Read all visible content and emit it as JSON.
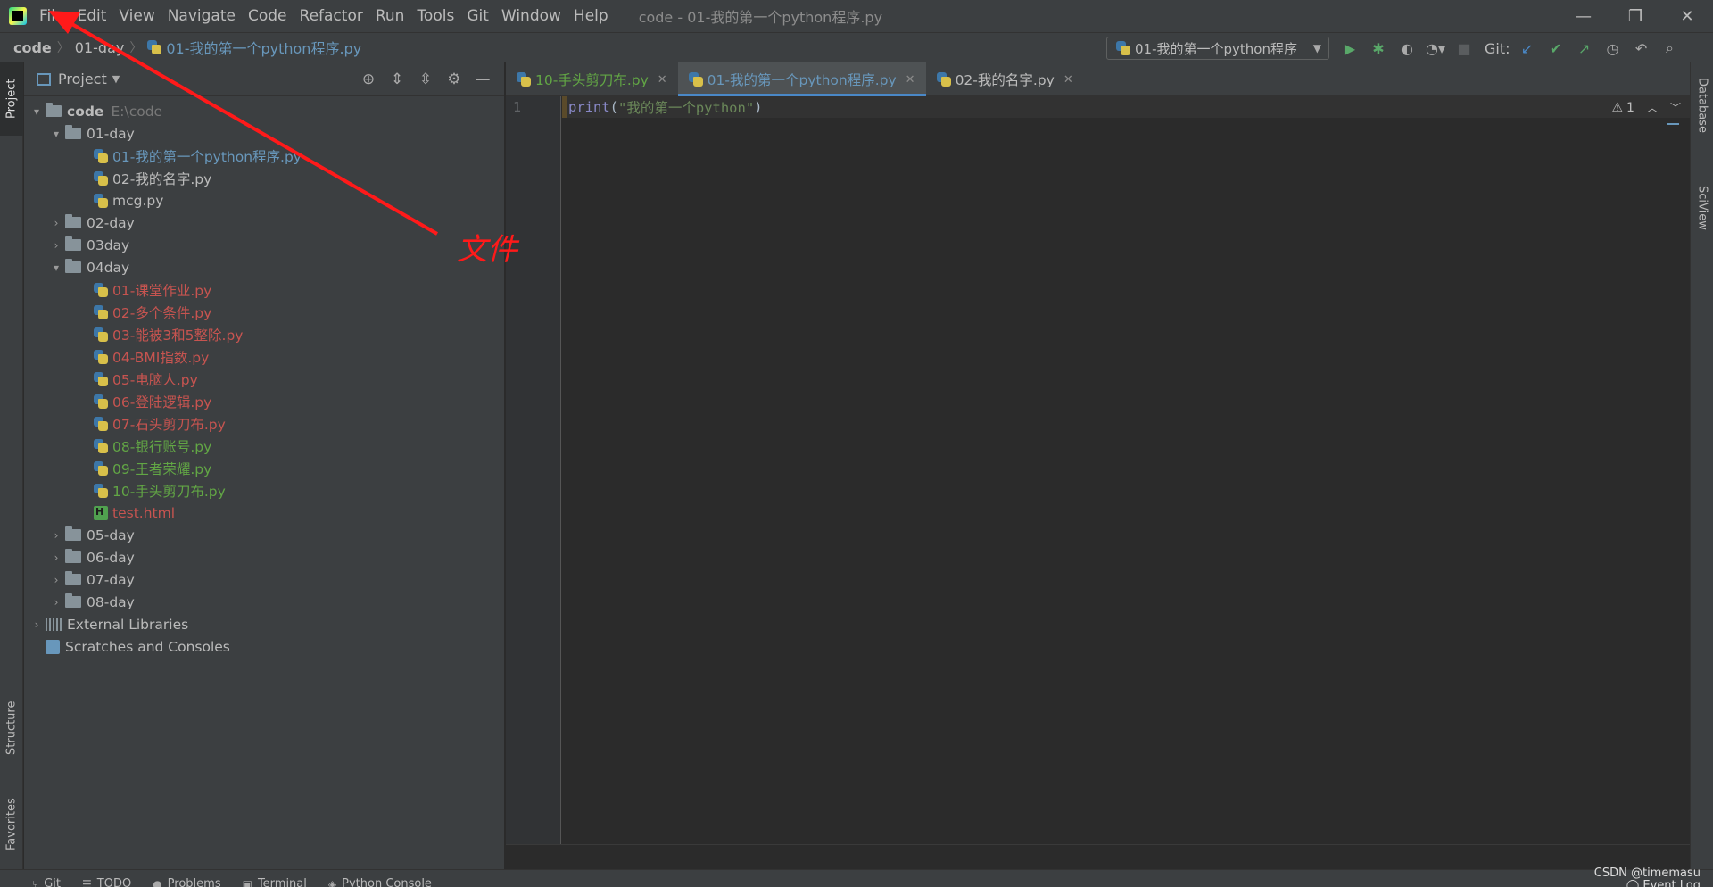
{
  "menubar": {
    "items": [
      "File",
      "Edit",
      "View",
      "Navigate",
      "Code",
      "Refactor",
      "Run",
      "Tools",
      "Git",
      "Window",
      "Help"
    ],
    "window_title": "code - 01-我的第一个python程序.py",
    "controls": {
      "minimize": "—",
      "restore": "❐",
      "close": "✕"
    }
  },
  "navbar": {
    "breadcrumbs": [
      "code",
      "01-day",
      "01-我的第一个python程序.py"
    ],
    "run_config": "01-我的第一个python程序",
    "git_label": "Git:"
  },
  "left_strip": {
    "tabs": [
      "Project",
      "Structure",
      "Favorites"
    ]
  },
  "right_strip": {
    "tabs": [
      "Database",
      "SciView"
    ]
  },
  "project_panel": {
    "title": "Project",
    "root": {
      "name": "code",
      "path": "E:\\code"
    },
    "tree": [
      {
        "label": "01-day",
        "type": "folder",
        "expanded": true
      },
      {
        "label": "01-我的第一个python程序.py",
        "type": "py",
        "status": "modified"
      },
      {
        "label": "02-我的名字.py",
        "type": "py",
        "status": "normal"
      },
      {
        "label": "mcg.py",
        "type": "py",
        "status": "normal"
      },
      {
        "label": "02-day",
        "type": "folder",
        "expanded": false
      },
      {
        "label": "03day",
        "type": "folder",
        "expanded": false
      },
      {
        "label": "04day",
        "type": "folder",
        "expanded": true
      },
      {
        "label": "01-课堂作业.py",
        "type": "py",
        "status": "unversioned"
      },
      {
        "label": "02-多个条件.py",
        "type": "py",
        "status": "unversioned"
      },
      {
        "label": "03-能被3和5整除.py",
        "type": "py",
        "status": "unversioned"
      },
      {
        "label": "04-BMI指数.py",
        "type": "py",
        "status": "unversioned"
      },
      {
        "label": "05-电脑人.py",
        "type": "py",
        "status": "unversioned"
      },
      {
        "label": "06-登陆逻辑.py",
        "type": "py",
        "status": "unversioned"
      },
      {
        "label": "07-石头剪刀布.py",
        "type": "py",
        "status": "unversioned"
      },
      {
        "label": "08-银行账号.py",
        "type": "py",
        "status": "added"
      },
      {
        "label": "09-王者荣耀.py",
        "type": "py",
        "status": "added"
      },
      {
        "label": "10-手头剪刀布.py",
        "type": "py",
        "status": "added"
      },
      {
        "label": "test.html",
        "type": "html",
        "status": "unversioned"
      },
      {
        "label": "05-day",
        "type": "folder",
        "expanded": false
      },
      {
        "label": "06-day",
        "type": "folder",
        "expanded": false
      },
      {
        "label": "07-day",
        "type": "folder",
        "expanded": false
      },
      {
        "label": "08-day",
        "type": "folder",
        "expanded": false
      }
    ],
    "external_libraries": "External Libraries",
    "scratches": "Scratches and Consoles"
  },
  "editor": {
    "tabs": [
      {
        "label": "10-手头剪刀布.py",
        "status": "added",
        "active": false
      },
      {
        "label": "01-我的第一个python程序.py",
        "status": "modified",
        "active": true
      },
      {
        "label": "02-我的名字.py",
        "status": "normal",
        "active": false
      }
    ],
    "line_number": "1",
    "code": {
      "func": "print",
      "open": "(",
      "string": "\"我的第一个python\"",
      "close": ")"
    },
    "warnings": "1"
  },
  "bottom_bar": {
    "tabs": [
      {
        "icon": "git-icon",
        "label": "Git"
      },
      {
        "icon": "todo-icon",
        "label": "TODO"
      },
      {
        "icon": "problems-icon",
        "label": "Problems"
      },
      {
        "icon": "terminal-icon",
        "label": "Terminal"
      },
      {
        "icon": "python-console-icon",
        "label": "Python Console"
      }
    ],
    "event_log": "Event Log"
  },
  "watermark": "CSDN @timemasu",
  "annotation": {
    "text": "文件",
    "color": "#ff1a1a"
  },
  "colors": {
    "modified": "#6897bb",
    "unversioned": "#c75450",
    "added": "#62a645",
    "accent": "#4a88c7",
    "background": "#2b2b2b",
    "panel": "#3c3f41"
  }
}
